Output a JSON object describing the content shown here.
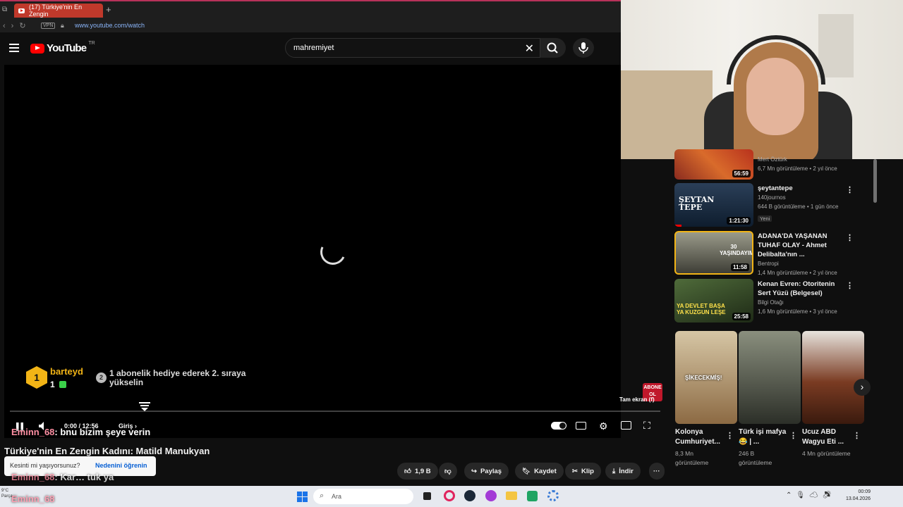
{
  "browser": {
    "tab_title": "(17) Türkiye'nin En Zengin",
    "new_tab": "+",
    "url": "www.youtube.com/watch",
    "vpn": "VPN"
  },
  "header": {
    "logo": "YouTube",
    "country": "TR",
    "search_value": "mahremiyet",
    "clear": "✕"
  },
  "player": {
    "time": "0:00 / 12:56",
    "login": "Giriş",
    "fullscreen_tip": "Tam ekran (f)",
    "abone_badge": "ABONE OL",
    "rank_badge": "1",
    "rank_user": "barteyd",
    "rank_count": "1",
    "gift_num": "2",
    "gift_text_1": "1 abonelik hediye ederek 2. sıraya",
    "gift_text_2": "yükselin",
    "chat": [
      {
        "user": "Eminn_68",
        "text": ": bnu bizim şeye verin"
      },
      {
        "user": "Eminn_68",
        "text": ": Kar… tuk ya"
      },
      {
        "user": "Eminn_68",
        "text": ""
      }
    ]
  },
  "video": {
    "title": "Türkiye'nin En Zengin Kadını: Matild Manukyan",
    "survey_q": "Kesinti mi yaşıyorsunuz?",
    "survey_link": "Nedenini öğrenin",
    "likes": "1,9 B",
    "share": "Paylaş",
    "save": "Kaydet",
    "clip": "Klip",
    "download": "İndir"
  },
  "sidebar": {
    "items": [
      {
        "title": "",
        "channel": "Mert Öztürk",
        "views": "6,7 Mn görüntüleme • 2 yıl önce",
        "duration": "56:59"
      },
      {
        "title": "şeytantepe",
        "channel": "140journos",
        "views": "644 B görüntüleme • 1 gün önce",
        "badge": "Yeni",
        "duration": "1:21:30",
        "thumb_text": "ŞEYTAN TEPE"
      },
      {
        "title": "ADANA'DA YAŞANAN TUHAF OLAY - Ahmet Delibalta'nın ...",
        "channel": "Bentropi",
        "views": "1,4 Mn görüntüleme • 2 yıl önce",
        "duration": "11:58",
        "thumb_text": "30 YAŞINDAYIM"
      },
      {
        "title": "Kenan Evren: Otoritenin Sert Yüzü (Belgesel)",
        "channel": "Bilgi Otağı",
        "views": "1,6 Mn görüntüleme • 3 yıl önce",
        "duration": "25:58",
        "thumb_text": "YA DEVLET BAŞA YA KUZGUN LEŞE"
      }
    ],
    "shorts": [
      {
        "title": "Kolonya Cumhuriyet...",
        "views": "8,3 Mn görüntüleme",
        "thumb_text": "ŞİKECEKMİŞ!"
      },
      {
        "title": "Türk işi mafya 😂 | ...",
        "views": "246 B görüntüleme"
      },
      {
        "title": "Ucuz ABD Wagyu Eti ...",
        "views": "4 Mn görüntüleme"
      }
    ]
  },
  "taskbar": {
    "search": "Ara",
    "weather_temp": "9°C",
    "weather_text": "Parça…",
    "time": "00:09",
    "date": "13.04.2026"
  },
  "colors": {
    "accent_red": "#ff0000",
    "chat_user": "#ff8fa3",
    "link_blue": "#3ea6ff"
  }
}
